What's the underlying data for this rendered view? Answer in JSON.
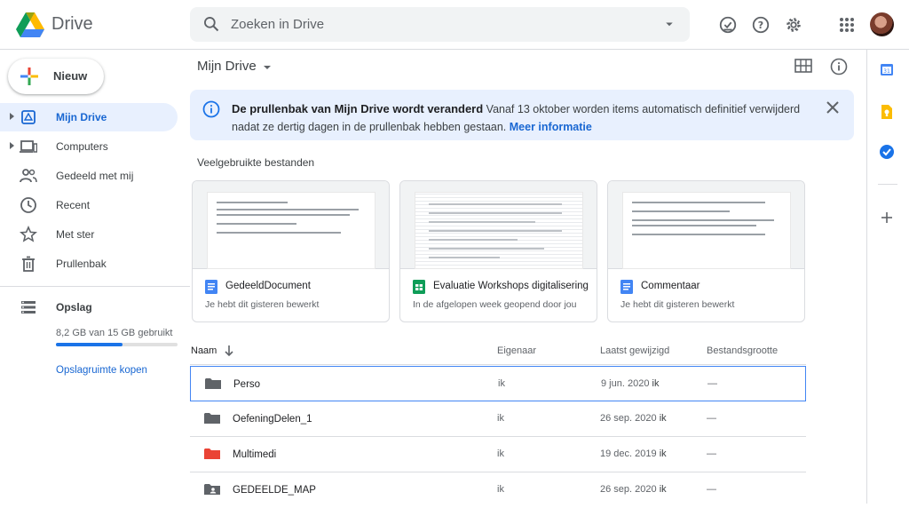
{
  "header": {
    "app_name": "Drive",
    "search_placeholder": "Zoeken in Drive"
  },
  "sidebar": {
    "new_label": "Nieuw",
    "items": [
      {
        "label": "Mijn Drive",
        "icon": "my-drive-icon"
      },
      {
        "label": "Computers",
        "icon": "computers-icon"
      },
      {
        "label": "Gedeeld met mij",
        "icon": "shared-icon"
      },
      {
        "label": "Recent",
        "icon": "clock-icon"
      },
      {
        "label": "Met ster",
        "icon": "star-icon"
      },
      {
        "label": "Prullenbak",
        "icon": "trash-icon"
      }
    ],
    "storage_label": "Opslag",
    "storage_usage": "8,2 GB van 15 GB gebruikt",
    "storage_fraction": 0.55,
    "buy_storage": "Opslagruimte kopen"
  },
  "main": {
    "breadcrumb": "Mijn Drive",
    "notice": {
      "title": "De prullenbak van Mijn Drive wordt veranderd",
      "body": "Vanaf 13 oktober worden items automatisch definitief verwijderd nadat ze dertig dagen in de prullenbak hebben gestaan.",
      "link": "Meer informatie"
    },
    "quick_access_title": "Veelgebruikte bestanden",
    "cards": [
      {
        "title": "GedeeldDocument",
        "subtitle": "Je hebt dit gisteren bewerkt",
        "type": "docs",
        "color": "#4285f4"
      },
      {
        "title": "Evaluatie Workshops digitalisering",
        "subtitle": "In de afgelopen week geopend door jou",
        "type": "sheets",
        "color": "#0f9d58"
      },
      {
        "title": "Commentaar",
        "subtitle": "Je hebt dit gisteren bewerkt",
        "type": "docs",
        "color": "#4285f4"
      }
    ],
    "columns": {
      "name": "Naam",
      "owner": "Eigenaar",
      "modified": "Laatst gewijzigd",
      "size": "Bestandsgrootte"
    },
    "rows": [
      {
        "name": "Perso",
        "owner": "ik",
        "date": "9 jun. 2020",
        "by": "ik",
        "size": "—",
        "folder_color": "#5f6368"
      },
      {
        "name": "OefeningDelen_1",
        "owner": "ik",
        "date": "26 sep. 2020",
        "by": "ik",
        "size": "—",
        "folder_color": "#5f6368"
      },
      {
        "name": "Multimedi",
        "owner": "ik",
        "date": "19 dec. 2019",
        "by": "ik",
        "size": "—",
        "folder_color": "#ea4335"
      },
      {
        "name": "GEDEELDE_MAP",
        "owner": "ik",
        "date": "26 sep. 2020",
        "by": "ik",
        "size": "—",
        "folder_color": "#5f6368"
      }
    ]
  }
}
